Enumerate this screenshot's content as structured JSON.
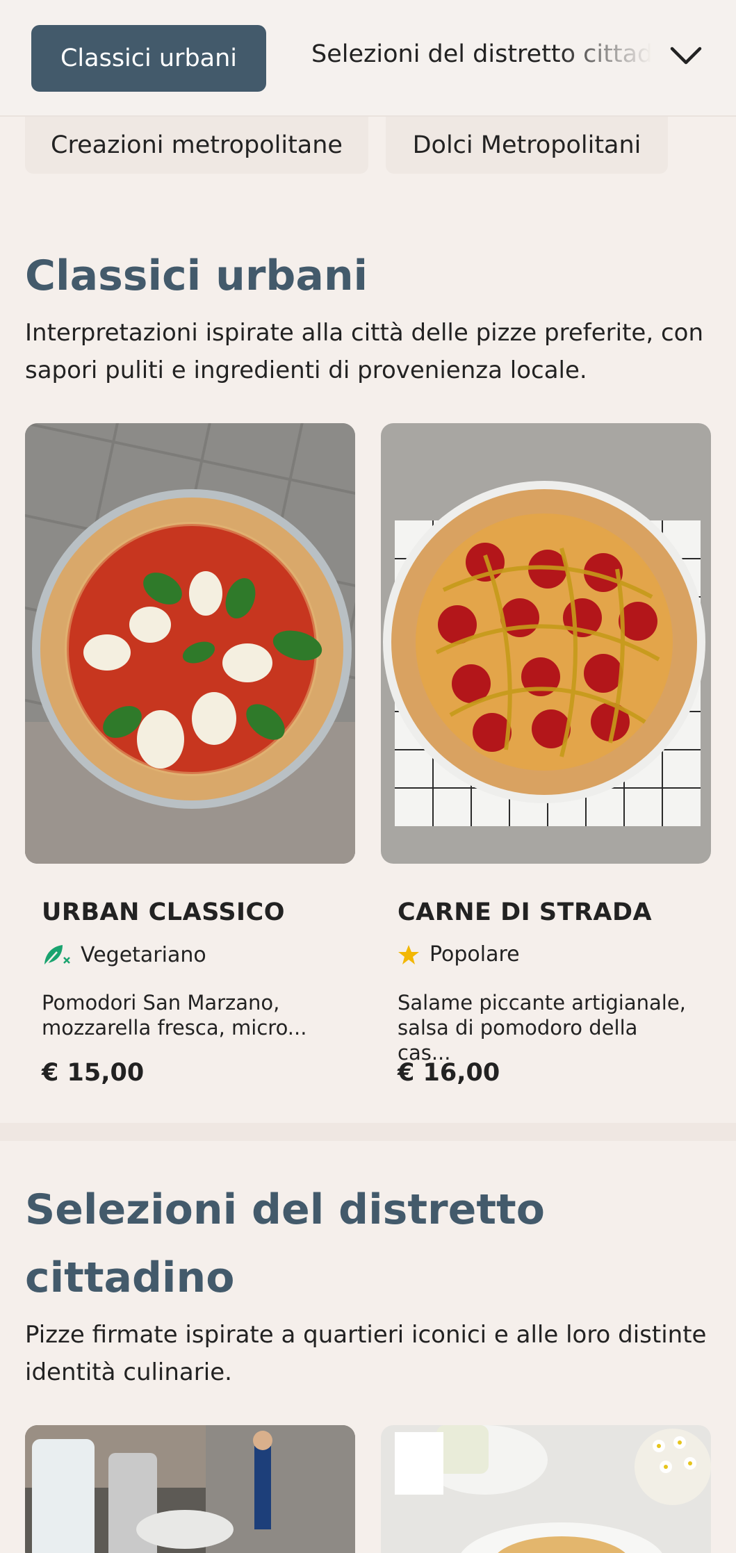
{
  "nav": {
    "active_tab": "Classici urbani",
    "next_tab": "Selezioni del distretto cittadino",
    "chevron_icon": "chevron-down-icon",
    "chips": [
      "Creazioni metropolitane",
      "Dolci Metropolitani"
    ]
  },
  "sections": [
    {
      "title": "Classici urbani",
      "description": "Interpretazioni ispirate alla città delle pizze preferite, con sapori puliti e ingredienti di provenienza locale.",
      "items": [
        {
          "name": "URBAN CLASSICO",
          "tag": "Vegetariano",
          "tag_icon": "leaf-icon",
          "tag_color": "#1aa36f",
          "description": "Pomodori San Marzano, mozzarella fresca, micro...",
          "price": "€ 15,00"
        },
        {
          "name": "CARNE DI STRADA",
          "tag": "Popolare",
          "tag_icon": "star-icon",
          "tag_color": "#f2b705",
          "description": "Salame piccante artigianale, salsa di pomodoro della cas...",
          "price": "€ 16,00"
        }
      ]
    },
    {
      "title_line1": "Selezioni del distretto",
      "title_line2": "cittadino",
      "description": "Pizze firmate ispirate a quartieri iconici e alle loro distinte identità culinarie."
    }
  ],
  "colors": {
    "accent": "#435a6b",
    "background": "#f5efeb"
  }
}
